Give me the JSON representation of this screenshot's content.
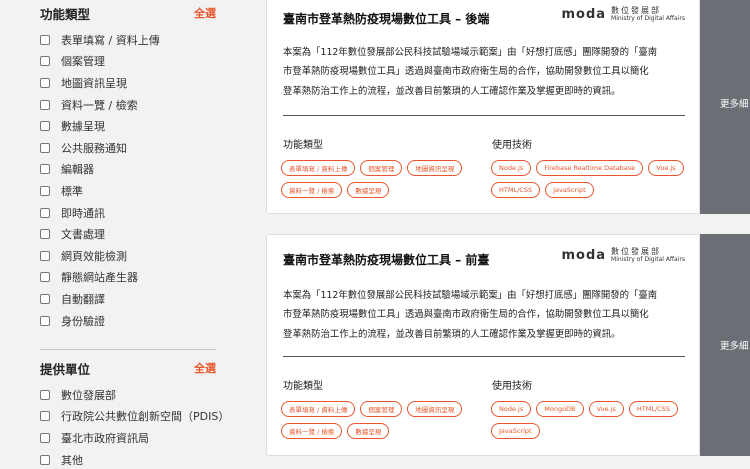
{
  "sidebar": {
    "function_filter": {
      "title": "功能類型",
      "select_all": "全選",
      "items": [
        "表單填寫 / 資料上傳",
        "個案管理",
        "地圖資訊呈現",
        "資料一覽 / 檢索",
        "數據呈現",
        "公共服務通知",
        "編輯器",
        "標準",
        "即時通訊",
        "文書處理",
        "網頁效能檢測",
        "靜態網站產生器",
        "自動翻譯",
        "身份驗證"
      ]
    },
    "provider_filter": {
      "title": "提供單位",
      "select_all": "全選",
      "items": [
        "數位發展部",
        "行政院公共數位創新空間（PDIS）",
        "臺北市政府資訊局",
        "其他"
      ]
    }
  },
  "logo": {
    "mark": "moda",
    "name_zh": "數位發展部",
    "name_en": "Ministry of Digital Affairs"
  },
  "cards": [
    {
      "title": "臺南市登革熱防疫現場數位工具 – 後端",
      "desc_lines": [
        "本案為「112年數位發展部公民科技試驗場域示範案」由「好想打底感」團隊開發的「臺南",
        "市登革熱防疫現場數位工具」透過與臺南市政府衛生局的合作，協助開發數位工具以簡化",
        "登革熱防治工作上的流程，並改善目前繁瑣的人工確認作業及掌握更即時的資訊。"
      ],
      "function_label": "功能類型",
      "function_tags": [
        "表單填寫 / 資料上傳",
        "個案管理",
        "地圖資訊呈現",
        "資料一覽 / 檢索",
        "數據呈現"
      ],
      "tech_label": "使用技術",
      "tech_tags": [
        "Node.js",
        "Firebase Realtime Database",
        "Vue.js",
        "HTML/CSS",
        "JavaScript"
      ],
      "more": "更多細"
    },
    {
      "title": "臺南市登革熱防疫現場數位工具 – 前臺",
      "desc_lines": [
        "本案為「112年數位發展部公民科技試驗場域示範案」由「好想打底感」團隊開發的「臺南",
        "市登革熱防疫現場數位工具」透過與臺南市政府衛生局的合作，協助開發數位工具以簡化",
        "登革熱防治工作上的流程，並改善目前繁瑣的人工確認作業及掌握更即時的資訊。"
      ],
      "function_label": "功能類型",
      "function_tags": [
        "表單填寫 / 資料上傳",
        "個案管理",
        "地圖資訊呈現",
        "資料一覽 / 檢索",
        "數據呈現"
      ],
      "tech_label": "使用技術",
      "tech_tags": [
        "Node.js",
        "MongoDB",
        "Vue.js",
        "HTML/CSS",
        "JavaScript"
      ],
      "more": "更多細"
    }
  ]
}
